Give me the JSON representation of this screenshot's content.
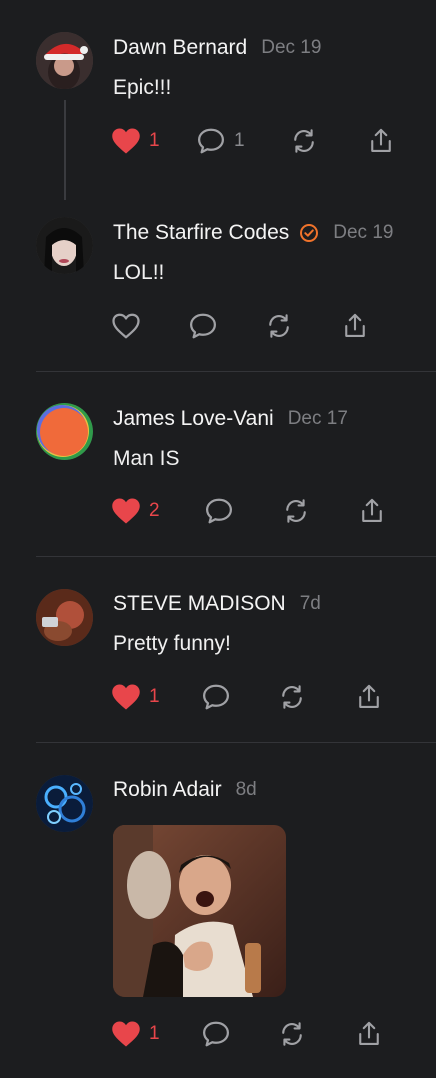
{
  "colors": {
    "background": "#1c1d1f",
    "like_active": "#e8464b",
    "icon": "#a0a1a5",
    "verified": "#f0732b"
  },
  "posts": [
    {
      "author": "Dawn Bernard",
      "date": "Dec 19",
      "text": "Epic!!!",
      "likes": "1",
      "liked": true,
      "replies": "1"
    },
    {
      "author": "The Starfire Codes",
      "date": "Dec 19",
      "text": "LOL!!",
      "liked": false,
      "verified": true
    },
    {
      "author": "James Love-Vani",
      "date": "Dec 17",
      "text": "Man IS",
      "likes": "2",
      "liked": true
    },
    {
      "author": "STEVE MADISON",
      "date": "7d",
      "text": "Pretty funny!",
      "likes": "1",
      "liked": true
    },
    {
      "author": "Robin Adair",
      "date": "8d",
      "text": "",
      "likes": "1",
      "liked": true,
      "has_gif": true
    }
  ]
}
